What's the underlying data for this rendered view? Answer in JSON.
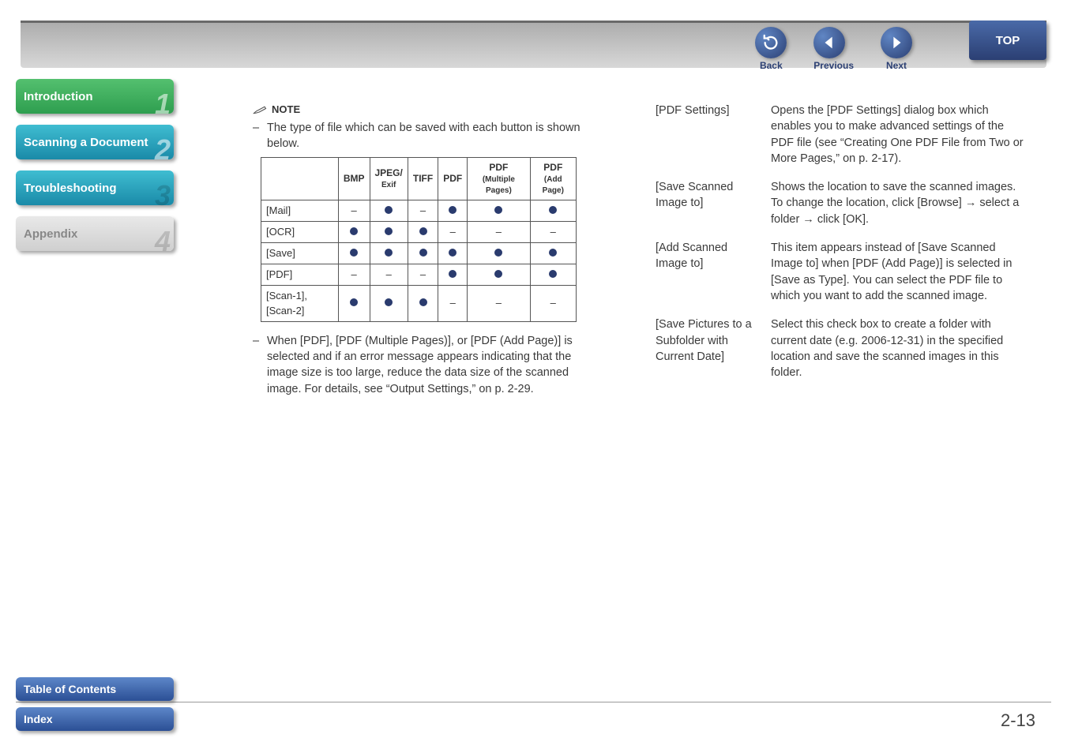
{
  "nav": {
    "back": "Back",
    "previous": "Previous",
    "next": "Next",
    "top": "TOP"
  },
  "sidebar": {
    "items": [
      {
        "label": "Introduction",
        "num": "1"
      },
      {
        "label": "Scanning a Document",
        "num": "2"
      },
      {
        "label": "Troubleshooting",
        "num": "3"
      },
      {
        "label": "Appendix",
        "num": "4"
      }
    ]
  },
  "footer": {
    "toc": "Table of Contents",
    "index": "Index"
  },
  "page_number": "2-13",
  "note": {
    "heading": "NOTE",
    "bullet1": "The type of file which can be saved with each button is shown below.",
    "bullet2": "When [PDF], [PDF (Multiple Pages)], or [PDF (Add Page)] is selected and if an error message appears indicating that the image size is too large, reduce the data size of the scanned image. For details, see “Output Settings,” on p. 2-29."
  },
  "table": {
    "headers": {
      "c1": "BMP",
      "c2_a": "JPEG/",
      "c2_b": "Exif",
      "c3": "TIFF",
      "c4": "PDF",
      "c5_a": "PDF",
      "c5_b": "(Multiple Pages)",
      "c6_a": "PDF",
      "c6_b": "(Add Page)"
    },
    "rows": [
      {
        "h": "[Mail]",
        "v": [
          "dash",
          "dot",
          "dash",
          "dot",
          "dot",
          "dot"
        ]
      },
      {
        "h": "[OCR]",
        "v": [
          "dot",
          "dot",
          "dot",
          "dash",
          "dash",
          "dash"
        ]
      },
      {
        "h": "[Save]",
        "v": [
          "dot",
          "dot",
          "dot",
          "dot",
          "dot",
          "dot"
        ]
      },
      {
        "h": "[PDF]",
        "v": [
          "dash",
          "dash",
          "dash",
          "dot",
          "dot",
          "dot"
        ]
      },
      {
        "h": "[Scan-1], [Scan-2]",
        "v": [
          "dot",
          "dot",
          "dot",
          "dash",
          "dash",
          "dash"
        ]
      }
    ]
  },
  "definitions": [
    {
      "term": "[PDF Settings]",
      "def": "Opens the [PDF Settings] dialog box which enables you to make advanced settings of the PDF file (see “Creating One PDF File from Two or More Pages,” on p. 2-17)."
    },
    {
      "term": "[Save Scanned Image to]",
      "def": "Shows the location to save the scanned images. To change the location, click [Browse] → select a folder → click [OK]."
    },
    {
      "term": "[Add Scanned Image to]",
      "def": "This item appears instead of [Save Scanned Image to] when [PDF (Add Page)] is selected in [Save as Type]. You can select the PDF file to which you want to add the scanned image."
    },
    {
      "term": "[Save Pictures to a Subfolder with Current Date]",
      "def": "Select this check box to create a folder with current date (e.g. 2006-12-31) in the specified location and save the scanned images in this folder."
    }
  ]
}
